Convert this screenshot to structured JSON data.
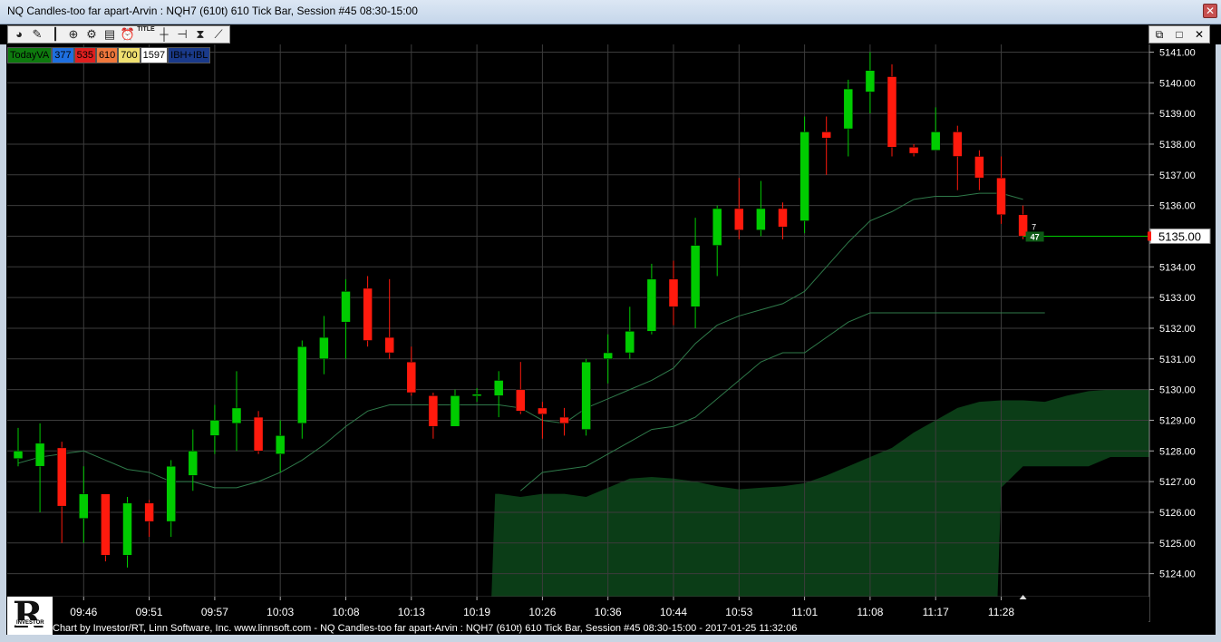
{
  "window": {
    "title": "NQ Candles-too far apart-Arvin : NQH7 (610t) 610 Tick Bar, Session #45 08:30-15:00",
    "close_label": "✕"
  },
  "toolbar": {
    "tools": [
      "cursor-icon",
      "pencil-icon",
      "candlestick-icon",
      "zoom-icon",
      "gear-icon",
      "layers-icon",
      "alarm-clock-icon",
      "title-icon",
      "crosshair-icon",
      "ruler-icon",
      "hourglass-icon",
      "draw-tools-icon"
    ],
    "title_tool_label": "TITLE",
    "mdi_buttons": [
      "⧉",
      "□",
      "✕"
    ]
  },
  "legend": [
    {
      "label": "TodayVA",
      "bg": "#0e7a0e",
      "fg": "#000000"
    },
    {
      "label": "377",
      "bg": "#1e6fe0",
      "fg": "#000000"
    },
    {
      "label": "535",
      "bg": "#e02020",
      "fg": "#000000"
    },
    {
      "label": "610",
      "bg": "#f0783c",
      "fg": "#000000"
    },
    {
      "label": "700",
      "bg": "#f0e070",
      "fg": "#000000"
    },
    {
      "label": "1597",
      "bg": "#ffffff",
      "fg": "#000000"
    },
    {
      "label": "IBH+IBL",
      "bg": "#1a3a8a",
      "fg": "#000000"
    }
  ],
  "footer": {
    "text": "Chart by Investor/RT, Linn Software, Inc. www.linnsoft.com - NQ Candles-too far apart-Arvin : NQH7 (610t) 610 Tick Bar, Session #45 08:30-15:00 - 2017-01-25 11:32:06"
  },
  "logo": {
    "letter": "R",
    "word": "INVESTOR"
  },
  "colors": {
    "up": "#00cc00",
    "down": "#ff1a0d",
    "grid": "#3c3c3c",
    "area": "#0b3d17",
    "area_grid": "#3f7a2b",
    "price_box": "#ffffff"
  },
  "chart_data": {
    "type": "candlestick",
    "y_ticks": [
      5124,
      5125,
      5126,
      5127,
      5128,
      5129,
      5130,
      5131,
      5132,
      5133,
      5134,
      5135,
      5136,
      5137,
      5138,
      5139,
      5140,
      5141
    ],
    "y_tick_labels": [
      "5124.00",
      "5125.00",
      "5126.00",
      "5127.00",
      "5128.00",
      "5129.00",
      "5130.00",
      "5131.00",
      "5132.00",
      "5133.00",
      "5134.00",
      "5135.00",
      "5136.00",
      "5137.00",
      "5138.00",
      "5139.00",
      "5140.00",
      "5141.00"
    ],
    "ylim": [
      5123.25,
      5141.25
    ],
    "x_tick_labels": [
      "09:46",
      "09:51",
      "09:57",
      "10:03",
      "10:08",
      "10:13",
      "10:19",
      "10:26",
      "10:36",
      "10:44",
      "10:53",
      "11:01",
      "11:08",
      "11:17",
      "11:28"
    ],
    "x_tick_bars": [
      3,
      6,
      9,
      12,
      15,
      18,
      21,
      24,
      27,
      30,
      33,
      36,
      39,
      42,
      45
    ],
    "candles": [
      [
        5127.75,
        5128.0,
        5128.75,
        5127.5
      ],
      [
        5127.5,
        5128.25,
        5128.9,
        5126.0
      ],
      [
        5128.1,
        5126.2,
        5128.3,
        5125.0
      ],
      [
        5125.8,
        5126.6,
        5127.5,
        5125.0
      ],
      [
        5126.6,
        5124.6,
        5126.6,
        5124.4
      ],
      [
        5124.6,
        5126.3,
        5126.5,
        5124.2
      ],
      [
        5126.3,
        5125.7,
        5126.4,
        5125.2
      ],
      [
        5125.7,
        5127.5,
        5127.7,
        5125.2
      ],
      [
        5127.2,
        5128.0,
        5128.7,
        5126.7
      ],
      [
        5128.5,
        5129.0,
        5129.5,
        5127.9
      ],
      [
        5128.9,
        5129.4,
        5130.6,
        5128.0
      ],
      [
        5129.1,
        5128.0,
        5129.3,
        5127.9
      ],
      [
        5127.9,
        5128.5,
        5129.0,
        5127.3
      ],
      [
        5128.9,
        5131.4,
        5131.6,
        5128.4
      ],
      [
        5131.0,
        5131.7,
        5132.4,
        5130.5
      ],
      [
        5132.2,
        5133.2,
        5133.6,
        5131.0
      ],
      [
        5133.3,
        5131.6,
        5133.7,
        5131.4
      ],
      [
        5131.7,
        5131.2,
        5133.6,
        5131.0
      ],
      [
        5130.9,
        5129.9,
        5131.4,
        5129.8
      ],
      [
        5129.8,
        5128.8,
        5129.9,
        5128.4
      ],
      [
        5128.8,
        5129.8,
        5130.0,
        5128.8
      ],
      [
        5129.85,
        5129.85,
        5130.05,
        5129.6
      ],
      [
        5129.8,
        5130.3,
        5130.6,
        5129.1
      ],
      [
        5130.0,
        5129.3,
        5130.9,
        5129.2
      ],
      [
        5129.4,
        5129.2,
        5129.6,
        5128.4
      ],
      [
        5129.1,
        5128.9,
        5129.4,
        5128.5
      ],
      [
        5128.7,
        5130.9,
        5131.0,
        5128.5
      ],
      [
        5131.0,
        5131.2,
        5131.8,
        5130.2
      ],
      [
        5131.2,
        5131.9,
        5132.7,
        5131.0
      ],
      [
        5131.9,
        5133.6,
        5134.1,
        5131.8
      ],
      [
        5133.6,
        5132.7,
        5134.2,
        5132.1
      ],
      [
        5132.7,
        5134.7,
        5135.6,
        5132.0
      ],
      [
        5134.7,
        5135.9,
        5136.0,
        5133.7
      ],
      [
        5135.9,
        5135.2,
        5136.9,
        5134.9
      ],
      [
        5135.2,
        5135.9,
        5136.8,
        5135.0
      ],
      [
        5135.9,
        5135.3,
        5136.1,
        5134.9
      ],
      [
        5135.5,
        5138.4,
        5138.9,
        5135.1
      ],
      [
        5138.4,
        5138.2,
        5138.9,
        5137.0
      ],
      [
        5138.5,
        5139.8,
        5140.1,
        5137.6
      ],
      [
        5139.7,
        5140.4,
        5141.0,
        5139.0
      ],
      [
        5140.2,
        5137.9,
        5140.6,
        5137.6
      ],
      [
        5137.9,
        5137.7,
        5138.0,
        5137.6
      ],
      [
        5137.8,
        5138.4,
        5139.2,
        5137.8
      ],
      [
        5138.4,
        5137.6,
        5138.6,
        5136.5
      ],
      [
        5137.6,
        5136.9,
        5137.8,
        5136.5
      ],
      [
        5136.9,
        5135.7,
        5137.6,
        5135.4
      ],
      [
        5135.7,
        5135.0,
        5136.0,
        5134.9
      ]
    ],
    "ma_line": [
      5127.6,
      5127.8,
      5127.9,
      5128.0,
      5127.7,
      5127.4,
      5127.3,
      5127.0,
      5127.0,
      5126.8,
      5126.8,
      5127.0,
      5127.3,
      5127.7,
      5128.2,
      5128.8,
      5129.3,
      5129.5,
      5129.5,
      5129.5,
      5129.5,
      5129.5,
      5129.5,
      5129.4,
      5129.0,
      5128.9,
      5129.4,
      5129.7,
      5130.0,
      5130.3,
      5130.7,
      5131.5,
      5132.1,
      5132.4,
      5132.6,
      5132.8,
      5133.2,
      5134.0,
      5134.8,
      5135.5,
      5135.8,
      5136.2,
      5136.3,
      5136.3,
      5136.4,
      5136.4,
      5136.2
    ],
    "slow_line": {
      "from_bar": 23,
      "values": [
        5126.7,
        5127.3,
        5127.4,
        5127.5,
        5127.9,
        5128.3,
        5128.7,
        5128.8,
        5129.1,
        5129.7,
        5130.3,
        5130.9,
        5131.2,
        5131.2,
        5131.7,
        5132.2,
        5132.5,
        5132.5,
        5132.5,
        5132.5,
        5132.5,
        5132.5,
        5132.5,
        5132.5,
        5132.5
      ]
    },
    "value_area": {
      "from_bar": 22,
      "upper": [
        5126.6,
        5126.5,
        5126.6,
        5126.6,
        5126.5,
        5126.8,
        5127.1,
        5127.15,
        5127.1,
        5127.0,
        5126.85,
        5126.75,
        5126.8,
        5126.85,
        5126.95,
        5127.2,
        5127.5,
        5127.8,
        5128.1,
        5128.6,
        5129.0,
        5129.4,
        5129.6,
        5129.65,
        5129.65,
        5129.6,
        5129.8,
        5129.95,
        5130.0,
        5130.0,
        5130.0,
        5129.95,
        5129.0
      ],
      "lower_to_bar": 45,
      "tail_bars": [
        45,
        46,
        47,
        48,
        49,
        50
      ],
      "tail_lower": [
        5126.8,
        5127.5,
        5127.5,
        5127.5,
        5127.5,
        5127.8
      ]
    },
    "last_price": 5135.0,
    "last_price_label": "5135.00",
    "last_bar_labels": {
      "top": "7",
      "bottom": "47"
    }
  }
}
